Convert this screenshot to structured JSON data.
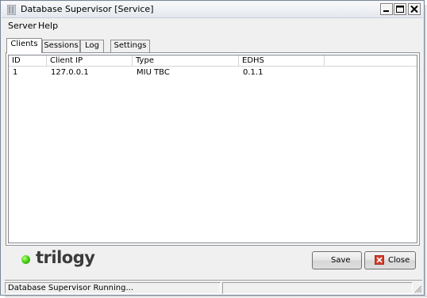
{
  "window": {
    "title": "Database Supervisor [Service]",
    "controls": {
      "minimize": "minimize-icon",
      "maximize": "maximize-icon",
      "close": "close-icon"
    }
  },
  "menu": {
    "items": [
      "Server",
      "Help"
    ]
  },
  "tabs": [
    "Clients",
    "Sessions",
    "Log",
    "Settings"
  ],
  "active_tab": "Clients",
  "clients_table": {
    "columns": [
      "ID",
      "Client IP",
      "Type",
      "EDHS"
    ],
    "rows": [
      [
        "1",
        "127.0.0.1",
        "MIU TBC",
        "0.1.1"
      ]
    ]
  },
  "logo": {
    "text": "trilogy",
    "dot_color": "#3cc81a"
  },
  "buttons": {
    "save": "Save",
    "close": "Close"
  },
  "status": {
    "message": "Database Supervisor Running...",
    "secondary": ""
  },
  "colors": {
    "close_icon_red": "#d23c2a"
  }
}
